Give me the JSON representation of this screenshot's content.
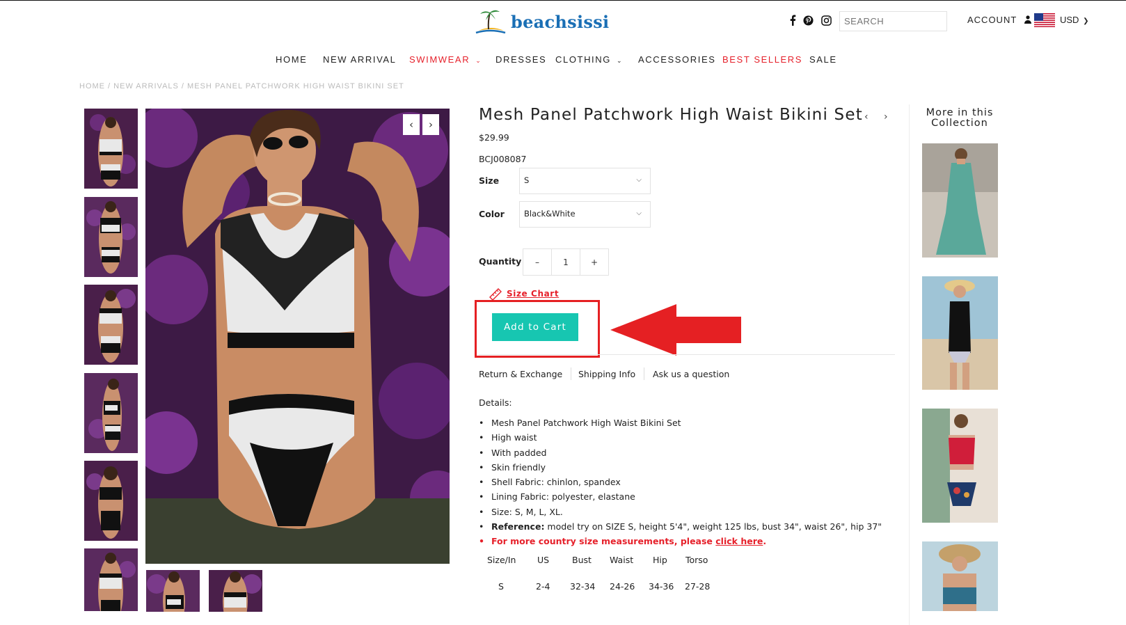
{
  "header": {
    "logo_text": "beachsissi",
    "search_placeholder": "SEARCH",
    "account_label": "ACCOUNT",
    "currency_label": "USD",
    "social_icons": [
      "facebook-icon",
      "pinterest-icon",
      "instagram-icon"
    ]
  },
  "nav": {
    "items": [
      {
        "label": "HOME"
      },
      {
        "label": "NEW ARRIVAL"
      },
      {
        "label": "SWIMWEAR",
        "has_dropdown": true,
        "color": "#e6212b"
      },
      {
        "label": "DRESSES"
      },
      {
        "label": "CLOTHING",
        "has_dropdown": true
      },
      {
        "label": "ACCESSORIES"
      },
      {
        "label": "BEST SELLERS",
        "color": "#e6212b"
      },
      {
        "label": "SALE"
      }
    ]
  },
  "breadcrumb": "HOME / NEW ARRIVALS / MESH PANEL PATCHWORK HIGH WAIST BIKINI SET",
  "product": {
    "title": "Mesh Panel Patchwork High Waist Bikini Set",
    "price": "$29.99",
    "sku": "BCJ008087",
    "size_label": "Size",
    "size_value": "S",
    "color_label": "Color",
    "color_value": "Black&White",
    "quantity_label": "Quantity",
    "quantity_value": "1",
    "minus": "–",
    "plus": "+",
    "size_chart": "Size Chart",
    "add_to_cart": "Add to Cart",
    "tabs": [
      "Return & Exchange",
      "Shipping Info",
      "Ask us a question"
    ],
    "details_heading": "Details:",
    "details": [
      "Mesh Panel Patchwork High Waist Bikini Set",
      "High waist",
      "With padded",
      "Skin friendly",
      "Shell Fabric: chinlon, spandex",
      "Lining Fabric: polyester, elastane",
      "Size: S, M, L, XL."
    ],
    "reference_label": "Reference:",
    "reference_text": " model try on SIZE S, height 5'4\", weight 125 lbs, bust 34\", waist 26\", hip 37\"",
    "country_text": "For more country size measurements, please ",
    "country_link": "click here",
    "country_end": ".",
    "size_table": {
      "headers": [
        "Size/In",
        "US",
        "Bust",
        "Waist",
        "Hip",
        "Torso"
      ],
      "rows": [
        [
          "S",
          "2-4",
          "32-34",
          "24-26",
          "34-36",
          "27-28"
        ]
      ]
    }
  },
  "more_collection": {
    "title_line1": "More in this",
    "title_line2": "Collection"
  },
  "colors": {
    "accent_red": "#e6212b",
    "cart_button": "#17c6b1",
    "highlight_box": "#e52023"
  }
}
